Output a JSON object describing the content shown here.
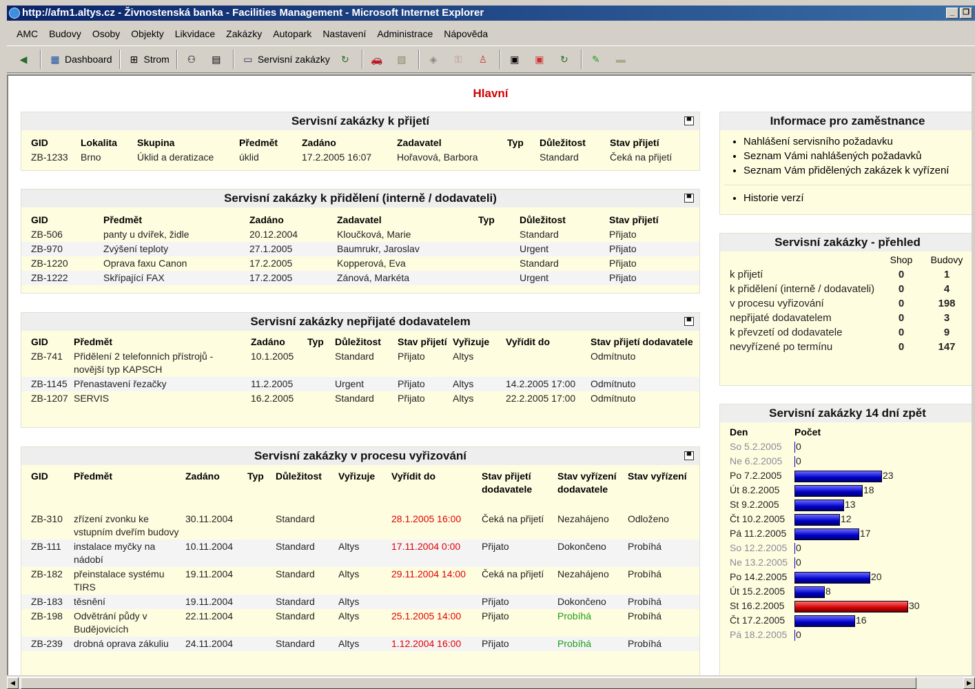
{
  "window": {
    "title": "http://afm1.altys.cz - Živnostenská banka - Facilities Management - Microsoft Internet Explorer"
  },
  "menu": [
    "AMC",
    "Budovy",
    "Osoby",
    "Objekty",
    "Likvidace",
    "Zakázky",
    "Autopark",
    "Nastavení",
    "Administrace",
    "Nápověda"
  ],
  "toolbar": {
    "dashboard": "Dashboard",
    "strom": "Strom",
    "servisni": "Servisní zakázky"
  },
  "page": {
    "title": "Hlavní"
  },
  "prijeti": {
    "title": "Servisní zakázky k přijetí",
    "headers": [
      "GID",
      "Lokalita",
      "Skupina",
      "Předmět",
      "Zadáno",
      "Zadavatel",
      "Typ",
      "Důležitost",
      "Stav přijetí"
    ],
    "rows": [
      [
        "ZB-1233",
        "Brno",
        "Úklid a deratizace",
        "úklid",
        "17.2.2005 16:07",
        "Hořavová, Barbora",
        "",
        "Standard",
        "Čeká na přijetí"
      ]
    ]
  },
  "prideleni": {
    "title": "Servisní zakázky k přidělení (interně / dodavateli)",
    "headers": [
      "GID",
      "Předmět",
      "Zadáno",
      "Zadavatel",
      "Typ",
      "Důležitost",
      "Stav přijetí"
    ],
    "rows": [
      [
        "ZB-506",
        "panty u dvířek, židle",
        "20.12.2004",
        "Kloučková, Marie",
        "",
        "Standard",
        "Přijato"
      ],
      [
        "ZB-970",
        "Zvýšení teploty",
        "27.1.2005",
        "Baumrukr, Jaroslav",
        "",
        "Urgent",
        "Přijato"
      ],
      [
        "ZB-1220",
        "Oprava faxu Canon",
        "17.2.2005",
        "Kopperová, Eva",
        "",
        "Standard",
        "Přijato"
      ],
      [
        "ZB-1222",
        "Skřípající FAX",
        "17.2.2005",
        "Zánová, Markéta",
        "",
        "Urgent",
        "Přijato"
      ]
    ]
  },
  "neprijate": {
    "title": "Servisní zakázky nepřijaté dodavatelem",
    "headers": [
      "GID",
      "Předmět",
      "Zadáno",
      "Typ",
      "Důležitost",
      "Stav přijetí",
      "Vyřizuje",
      "Vyřídit do",
      "Stav přijetí dodavatele"
    ],
    "rows": [
      [
        "ZB-741",
        "Přidělení 2 telefonních přístrojů - novější typ KAPSCH",
        "10.1.2005",
        "",
        "Standard",
        "Přijato",
        "Altys",
        "",
        "Odmítnuto"
      ],
      [
        "ZB-1145",
        "Přenastavení řezačky",
        "11.2.2005",
        "",
        "Urgent",
        "Přijato",
        "Altys",
        "14.2.2005 17:00",
        "Odmítnuto"
      ],
      [
        "ZB-1207",
        "SERVIS",
        "16.2.2005",
        "",
        "Standard",
        "Přijato",
        "Altys",
        "22.2.2005 17:00",
        "Odmítnuto"
      ]
    ]
  },
  "proces": {
    "title": "Servisní zakázky v procesu vyřizování",
    "headers": [
      "GID",
      "Předmět",
      "Zadáno",
      "Typ",
      "Důležitost",
      "Vyřizuje",
      "Vyřídit do",
      "Stav přijetí dodavatele",
      "Stav vyřízení dodavatele",
      "Stav vyřízení"
    ],
    "rows": [
      [
        "ZB-310",
        "zřízení zvonku ke vstupním dveřím budovy",
        "30.11.2004",
        "",
        "Standard",
        "",
        "28.1.2005 16:00",
        "Čeká na přijetí",
        "Nezahájeno",
        "Odloženo"
      ],
      [
        "ZB-111",
        "instalace myčky na nádobí",
        "10.11.2004",
        "",
        "Standard",
        "Altys",
        "17.11.2004 0:00",
        "Přijato",
        "Dokončeno",
        "Probíhá"
      ],
      [
        "ZB-182",
        "přeinstalace systému TIRS",
        "19.11.2004",
        "",
        "Standard",
        "Altys",
        "29.11.2004 14:00",
        "Čeká na přijetí",
        "Nezahájeno",
        "Probíhá"
      ],
      [
        "ZB-183",
        "těsnění",
        "19.11.2004",
        "",
        "Standard",
        "Altys",
        "",
        "Přijato",
        "Dokončeno",
        "Probíhá"
      ],
      [
        "ZB-198",
        "Odvětrání půdy v Budějovicích",
        "22.11.2004",
        "",
        "Standard",
        "Altys",
        "25.1.2005 14:00",
        "Přijato",
        "Probíhá",
        "Probíhá"
      ],
      [
        "ZB-239",
        "drobná oprava zákuliu",
        "24.11.2004",
        "",
        "Standard",
        "Altys",
        "1.12.2004 16:00",
        "Přijato",
        "Probíhá",
        "Probíhá"
      ]
    ]
  },
  "info": {
    "title": "Informace pro zaměstnance",
    "links": [
      "Nahlášení servisního požadavku",
      "Seznam Vámi nahlášených požadavků",
      "Seznam Vám přidělených zakázek k vyřízení"
    ],
    "extra": "Historie verzí"
  },
  "prehled": {
    "title": "Servisní zakázky - přehled",
    "col_shop": "Shop",
    "col_budovy": "Budovy",
    "rows": [
      {
        "label": "k přijetí",
        "shop": "0",
        "budovy": "1"
      },
      {
        "label": "k přidělení (interně / dodavateli)",
        "shop": "0",
        "budovy": "4"
      },
      {
        "label": "v procesu vyřizování",
        "shop": "0",
        "budovy": "198"
      },
      {
        "label": "nepřijaté dodavatelem",
        "shop": "0",
        "budovy": "3"
      },
      {
        "label": "k převzetí od dodavatele",
        "shop": "0",
        "budovy": "9"
      },
      {
        "label": "nevyřízené po termínu",
        "shop": "0",
        "budovy": "147"
      }
    ]
  },
  "chart_data": {
    "type": "bar",
    "title": "Servisní zakázky 14 dní zpět",
    "xlabel": "Den",
    "ylabel": "Počet",
    "categories": [
      "So 5.2.2005",
      "Ne 6.2.2005",
      "Po 7.2.2005",
      "Út 8.2.2005",
      "St 9.2.2005",
      "Čt 10.2.2005",
      "Pá 11.2.2005",
      "So 12.2.2005",
      "Ne 13.2.2005",
      "Po 14.2.2005",
      "Út 15.2.2005",
      "St 16.2.2005",
      "Čt 17.2.2005",
      "Pá 18.2.2005"
    ],
    "values": [
      0,
      0,
      23,
      18,
      13,
      12,
      17,
      0,
      0,
      20,
      8,
      30,
      16,
      0
    ],
    "highlight_color": "#d00000",
    "bar_color": "#0000c8",
    "weekend_color": "#8a8a9a"
  }
}
